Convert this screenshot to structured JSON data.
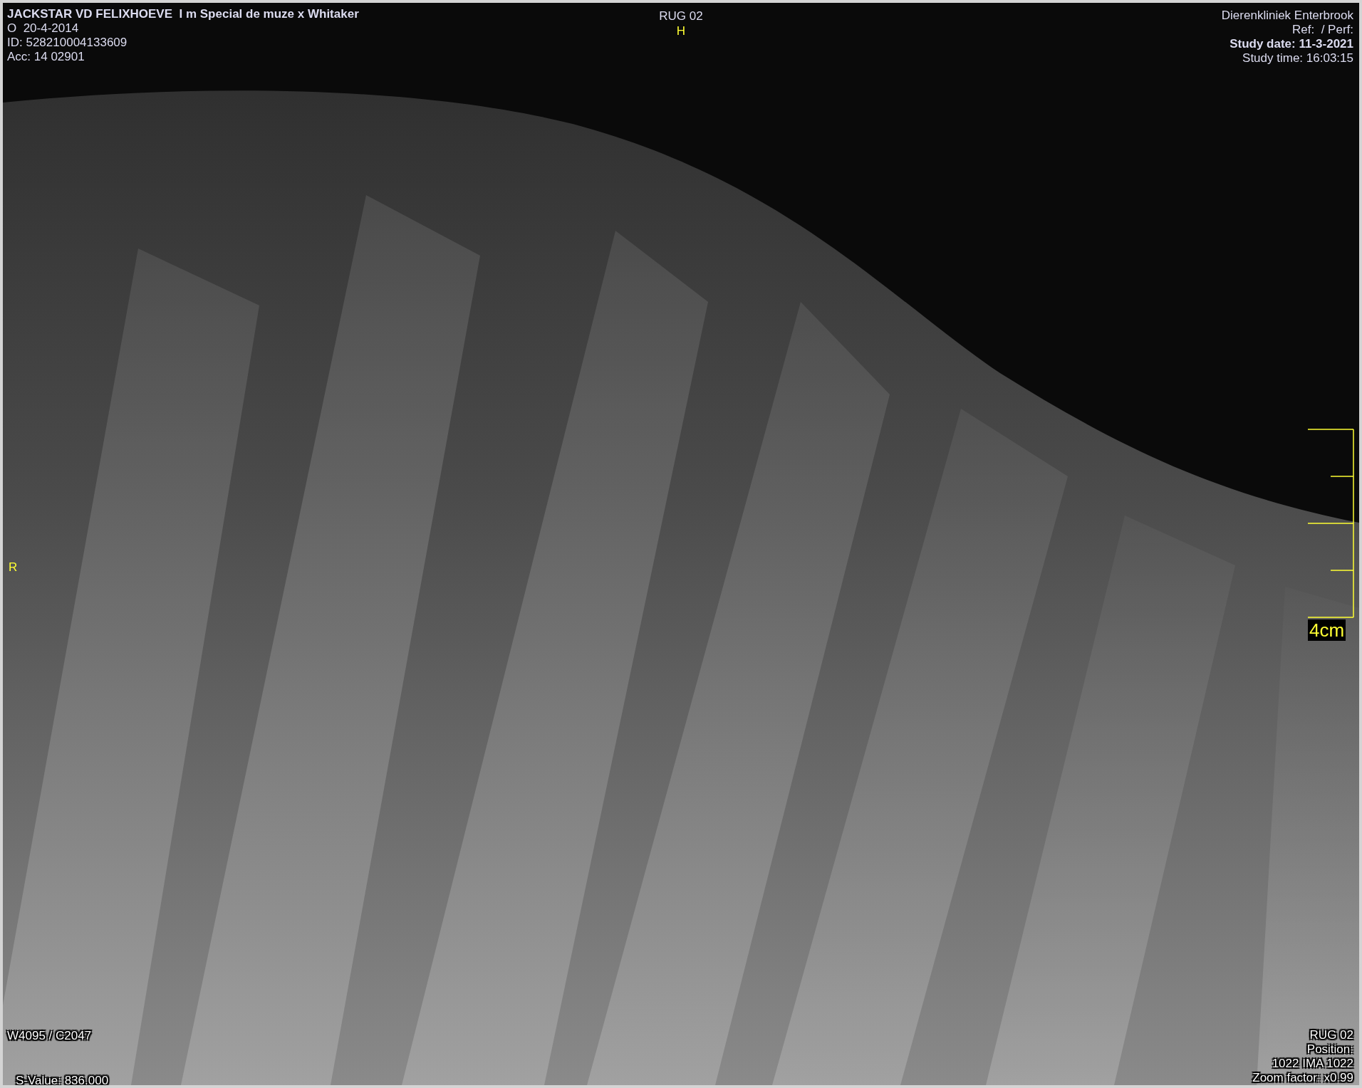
{
  "top_left": [
    {
      "text": "JACKSTAR VD FELIXHOEVE  I m Special de muze x Whitaker",
      "bold": true
    },
    {
      "text": "O  20-4-2014",
      "bold": false
    },
    {
      "text": "ID: 528210004133609",
      "bold": false
    },
    {
      "text": "Acc: 14 02901",
      "bold": false
    }
  ],
  "top_center": {
    "series": "RUG 02",
    "orientation": "H"
  },
  "top_right": [
    {
      "text": "Dierenkliniek Enterbrook",
      "bold": false
    },
    {
      "text": "Ref:  / Perf:",
      "bold": false
    },
    {
      "text": "Study date: 11-3-2021",
      "bold": true
    },
    {
      "text": "Study time: 16:03:15",
      "bold": false
    }
  ],
  "side_marker": "R",
  "ruler": {
    "label": "4cm"
  },
  "bottom_left": {
    "window_level": "W4095 / C2047",
    "s_value": "S-Value: 836.000"
  },
  "bottom_right": [
    "RUG 02",
    "Position:",
    "1022 IMA 1022",
    "Zoom factor: x0.99"
  ]
}
